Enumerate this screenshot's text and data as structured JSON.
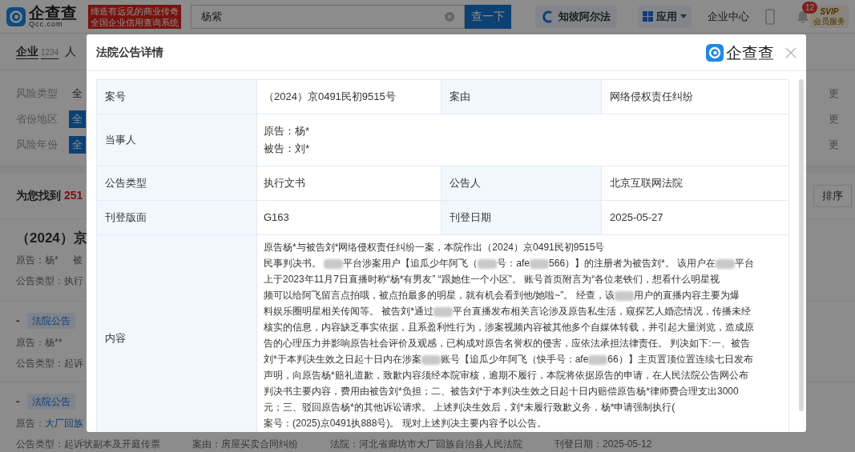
{
  "topbar": {
    "logo_text": "企查查",
    "logo_sub": "Qcc.com",
    "banner": [
      "缔造有远见的商业传奇",
      "全国企业信用查询系统"
    ],
    "search": {
      "value": "杨紫"
    },
    "search_button": "查一下",
    "alpha": "知彼阿尔法",
    "apps": "应用",
    "enterprise_center": "企业中心",
    "notifications": "12",
    "vip": {
      "badge": "SVIP",
      "label": "会员服务"
    }
  },
  "page": {
    "tabs": [
      {
        "label": "企业",
        "count": "1234",
        "selected": true
      },
      {
        "label": "人",
        "selected": false
      }
    ],
    "filters": [
      {
        "label": "风险类型",
        "option": "全",
        "selected": false,
        "more": "更"
      },
      {
        "label": "省份地区",
        "option": "全",
        "selected": true,
        "more": "更"
      },
      {
        "label": "风险年份",
        "option": "全",
        "selected": true,
        "more": "更"
      }
    ],
    "found": {
      "prefix": "为您找到",
      "count": "251"
    },
    "sort": "排序",
    "results": [
      {
        "title": "（2024）京",
        "lines": [
          [
            {
              "text": "原告：杨*",
              "link": false
            },
            {
              "text": "被",
              "link": false
            }
          ],
          [
            {
              "text": "公告类型：执行",
              "link": false
            }
          ]
        ]
      },
      {
        "dash": "-",
        "tag": "法院公告",
        "lines": [
          [
            {
              "text": "原告：杨**",
              "link": false
            }
          ],
          [
            {
              "text": "公告类型：起诉",
              "link": false
            }
          ]
        ]
      },
      {
        "dash": "-",
        "tag": "法院公告",
        "lines": [
          [
            {
              "text": "原告：",
              "link": false
            },
            {
              "text": "大厂回族",
              "link": true
            }
          ],
          [
            {
              "text": "公告类型：起诉状副本及开庭传票",
              "link": false
            },
            {
              "text": "案由：房屋买卖合同纠纷",
              "link": false
            },
            {
              "text": "法院：河北省廊坊市大厂回族自治县人民法院",
              "link": false
            },
            {
              "text": "刊登日期：2025-05-12",
              "link": false
            }
          ]
        ]
      }
    ]
  },
  "dialog": {
    "title": "法院公告详情",
    "logo_text": "企查查",
    "rows": [
      {
        "label": "案号",
        "value": [
          "（2024）京0491民初9515号"
        ],
        "label2": "案由",
        "value2": "网络侵权责任纠纷"
      },
      {
        "label": "当事人",
        "value": [
          "原告：杨*",
          "被告：刘*"
        ]
      },
      {
        "label": "公告类型",
        "value": [
          "执行文书"
        ],
        "label2": "公告人",
        "value2": "北京互联网法院"
      },
      {
        "label": "刊登版面",
        "value": [
          "G163"
        ],
        "label2": "刊登日期",
        "value2": "2025-05-27"
      }
    ],
    "content": {
      "label": "内容",
      "lines": [
        [
          {
            "kind": "text",
            "text": "原告杨*与被告刘*网络侵权责任纠纷一案，本院作出（2024）京0491民初9515号"
          }
        ],
        [
          {
            "kind": "text",
            "text": "民事判决书。 "
          },
          {
            "kind": "redacted"
          },
          {
            "kind": "text",
            "text": "平台涉案用户【追瓜少年阿飞（"
          },
          {
            "kind": "redacted"
          },
          {
            "kind": "text",
            "text": "号：afe"
          },
          {
            "kind": "redacted"
          },
          {
            "kind": "text",
            "text": "566）】的注册者为被告刘*。 该用户在"
          },
          {
            "kind": "redacted"
          },
          {
            "kind": "text",
            "text": "平台"
          }
        ],
        [
          {
            "kind": "text",
            "text": "上于2023年11月7日直播时称“杨*有男友” “跟她住一个小区”。 账号首页附言为“各位老铁们，想看什么明星视"
          }
        ],
        [
          {
            "kind": "text",
            "text": "频可以给阿飞留言点拍哦，被点拍最多的明星，就有机会看到他/她啦~”。 经查，该"
          },
          {
            "kind": "redacted"
          },
          {
            "kind": "text",
            "text": "用户的直播内容主要为爆"
          }
        ],
        [
          {
            "kind": "text",
            "text": "料娱乐圈明星相关传闻等。 被告刘*通过"
          },
          {
            "kind": "redacted"
          },
          {
            "kind": "text",
            "text": "平台直播发布相关言论涉及原告私生活，窥探艺人婚恋情况，传播未经"
          }
        ],
        [
          {
            "kind": "text",
            "text": "核实的信息，内容缺乏事实依据，且系盈利性行为，涉案视频内容被其他多个自媒体转载，并引起大量浏览，造成原"
          }
        ],
        [
          {
            "kind": "text",
            "text": "告的心理压力并影响原告社会评价及观感，已构成对原告名誉权的侵害，应依法承担法律责任。 判决如下:一、被告"
          }
        ],
        [
          {
            "kind": "text",
            "text": "刘*于本判决生效之日起十日内在涉案"
          },
          {
            "kind": "redacted"
          },
          {
            "kind": "text",
            "text": "账号【追瓜少年阿飞（快手号：afe"
          },
          {
            "kind": "redacted"
          },
          {
            "kind": "text",
            "text": "66）】主页置顶位置连续七日发布"
          }
        ],
        [
          {
            "kind": "text",
            "text": "声明，向原告杨*赔礼道歉，致歉内容须经本院审核，逾期不履行，本院将依据原告的申请，在人民法院公告网公布"
          }
        ],
        [
          {
            "kind": "text",
            "text": "判决书主要内容，费用由被告刘*负担；二、被告刘*于本判决生效之日起十日内赔偿原告杨*律师费合理支出3000"
          }
        ],
        [
          {
            "kind": "text",
            "text": "元；三、驳回原告杨*的其他诉讼请求。 上述判决生效后，刘*未履行致歉义务，杨*申请强制执行("
          }
        ],
        [
          {
            "kind": "text",
            "text": "案号：(2025)京0491执888号)。 现对上述判决主要内容予以公告。"
          }
        ]
      ]
    }
  }
}
